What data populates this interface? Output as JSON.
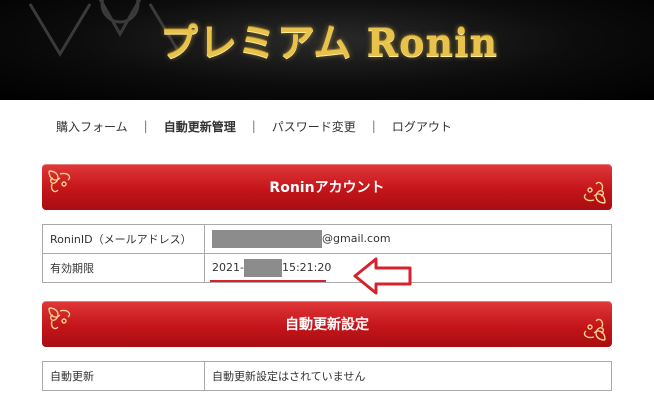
{
  "header": {
    "logo_text": "プレミアム Ronin"
  },
  "nav": {
    "items": [
      {
        "label": "購入フォーム"
      },
      {
        "label": "自動更新管理"
      },
      {
        "label": "パスワード変更"
      },
      {
        "label": "ログアウト"
      }
    ],
    "separator": "|",
    "active_index": 1
  },
  "account_section": {
    "title": "Roninアカウント",
    "rows": [
      {
        "label": "RoninID（メールアドレス）",
        "value_suffix": "@gmail.com"
      },
      {
        "label": "有効期限",
        "value_prefix": "2021-",
        "value_suffix": "15:21:20"
      }
    ]
  },
  "auto_renew_section": {
    "title": "自動更新設定",
    "rows": [
      {
        "label": "自動更新",
        "value": "自動更新設定はされていません"
      }
    ]
  },
  "colors": {
    "accent_red": "#c4151a",
    "annotation_red": "#d6222a",
    "logo_gold": "#e8c24a",
    "redaction_gray": "#8c8c8c"
  },
  "icons": [
    "ornament-corner-icon",
    "annotation-arrow-icon"
  ]
}
